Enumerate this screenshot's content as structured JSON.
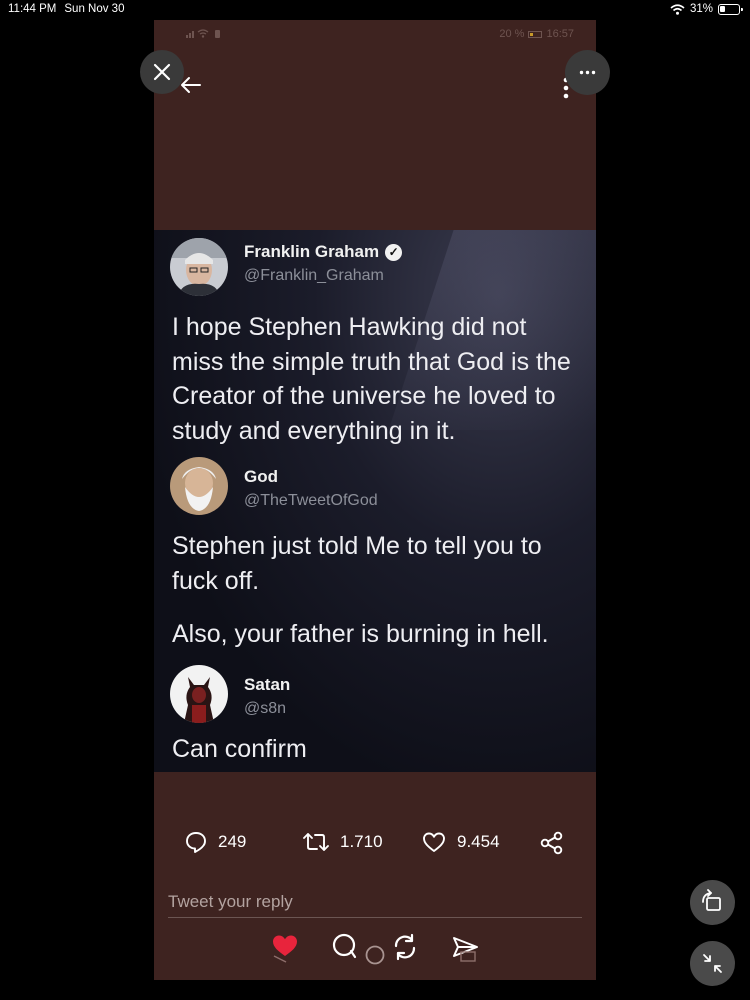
{
  "status_bar": {
    "time": "11:44 PM",
    "date": "Sun Nov 30",
    "battery": "31%"
  },
  "phone_status": {
    "battery": "20 %",
    "time": "16:57"
  },
  "tweets": [
    {
      "name": "Franklin Graham",
      "handle": "@Franklin_Graham",
      "verified": true,
      "text": "I hope Stephen Hawking did not miss the simple truth that God is the Creator of the universe he loved to study and everything in it."
    },
    {
      "name": "God",
      "handle": "@TheTweetOfGod",
      "text": "Stephen just told Me to tell you to fuck off.",
      "text2": "Also, your father is burning in hell."
    },
    {
      "name": "Satan",
      "handle": "@s8n",
      "text": "Can confirm"
    }
  ],
  "stats": {
    "replies": "249",
    "retweets": "1.710",
    "likes": "9.454"
  },
  "reply": {
    "placeholder": "Tweet your reply"
  },
  "icons": {
    "close": "close-icon",
    "more": "more-horizontal-icon",
    "back": "back-arrow-icon",
    "kebab": "more-vertical-icon",
    "reply": "comment-icon",
    "retweet": "retweet-icon",
    "like": "heart-icon",
    "share": "share-icon",
    "rotate": "rotate-icon",
    "collapse": "collapse-icon"
  },
  "colors": {
    "panel_bg": "#3e2320",
    "heart": "#e8243c",
    "overlay_btn": "#3a3a3a"
  }
}
